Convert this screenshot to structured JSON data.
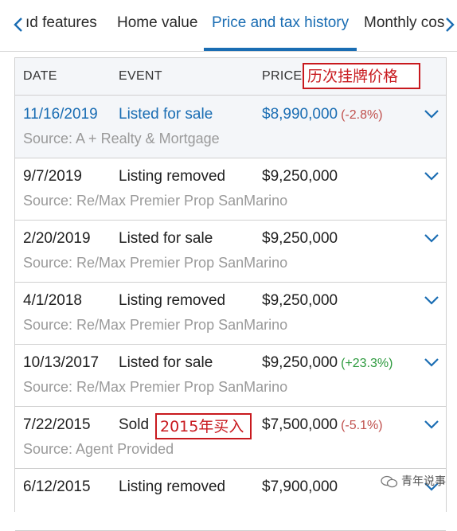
{
  "tabs": [
    {
      "label": "ıd features"
    },
    {
      "label": "Home value"
    },
    {
      "label": "Price and tax history"
    },
    {
      "label": "Monthly cos"
    }
  ],
  "active_tab": "Price and tax history",
  "colors": {
    "accent": "#1a6db3",
    "annotation": "#c8191e",
    "negative": "#c0504d",
    "positive": "#2d9a3e"
  },
  "table": {
    "headers": {
      "date": "DATE",
      "event": "EVENT",
      "price": "PRICE"
    },
    "price_annotation": "历次挂牌价格",
    "rows": [
      {
        "date": "11/16/2019",
        "event": "Listed for sale",
        "price": "$8,990,000",
        "change": "(-2.8%)",
        "source": "Source: A + Realty & Mortgage"
      },
      {
        "date": "9/7/2019",
        "event": "Listing removed",
        "price": "$9,250,000",
        "change": "",
        "source": "Source: Re/Max Premier Prop SanMarino"
      },
      {
        "date": "2/20/2019",
        "event": "Listed for sale",
        "price": "$9,250,000",
        "change": "",
        "source": "Source: Re/Max Premier Prop SanMarino"
      },
      {
        "date": "4/1/2018",
        "event": "Listing removed",
        "price": "$9,250,000",
        "change": "",
        "source": "Source: Re/Max Premier Prop SanMarino"
      },
      {
        "date": "10/13/2017",
        "event": "Listed for sale",
        "price": "$9,250,000",
        "change": "(+23.3%)",
        "source": "Source: Re/Max Premier Prop SanMarino"
      },
      {
        "date": "7/22/2015",
        "event": "Sold",
        "price": "$7,500,000",
        "change": "(-5.1%)",
        "source": "Source: Agent Provided",
        "annotation": "2015年买入"
      },
      {
        "date": "6/12/2015",
        "event": "Listing removed",
        "price": "$7,900,000",
        "change": "",
        "source": ""
      }
    ]
  },
  "watermark": "青年说事",
  "icons": {
    "prev": "chevron-left-icon",
    "next": "chevron-right-icon",
    "expand": "chevron-down-icon",
    "watermark": "wechat-icon"
  }
}
